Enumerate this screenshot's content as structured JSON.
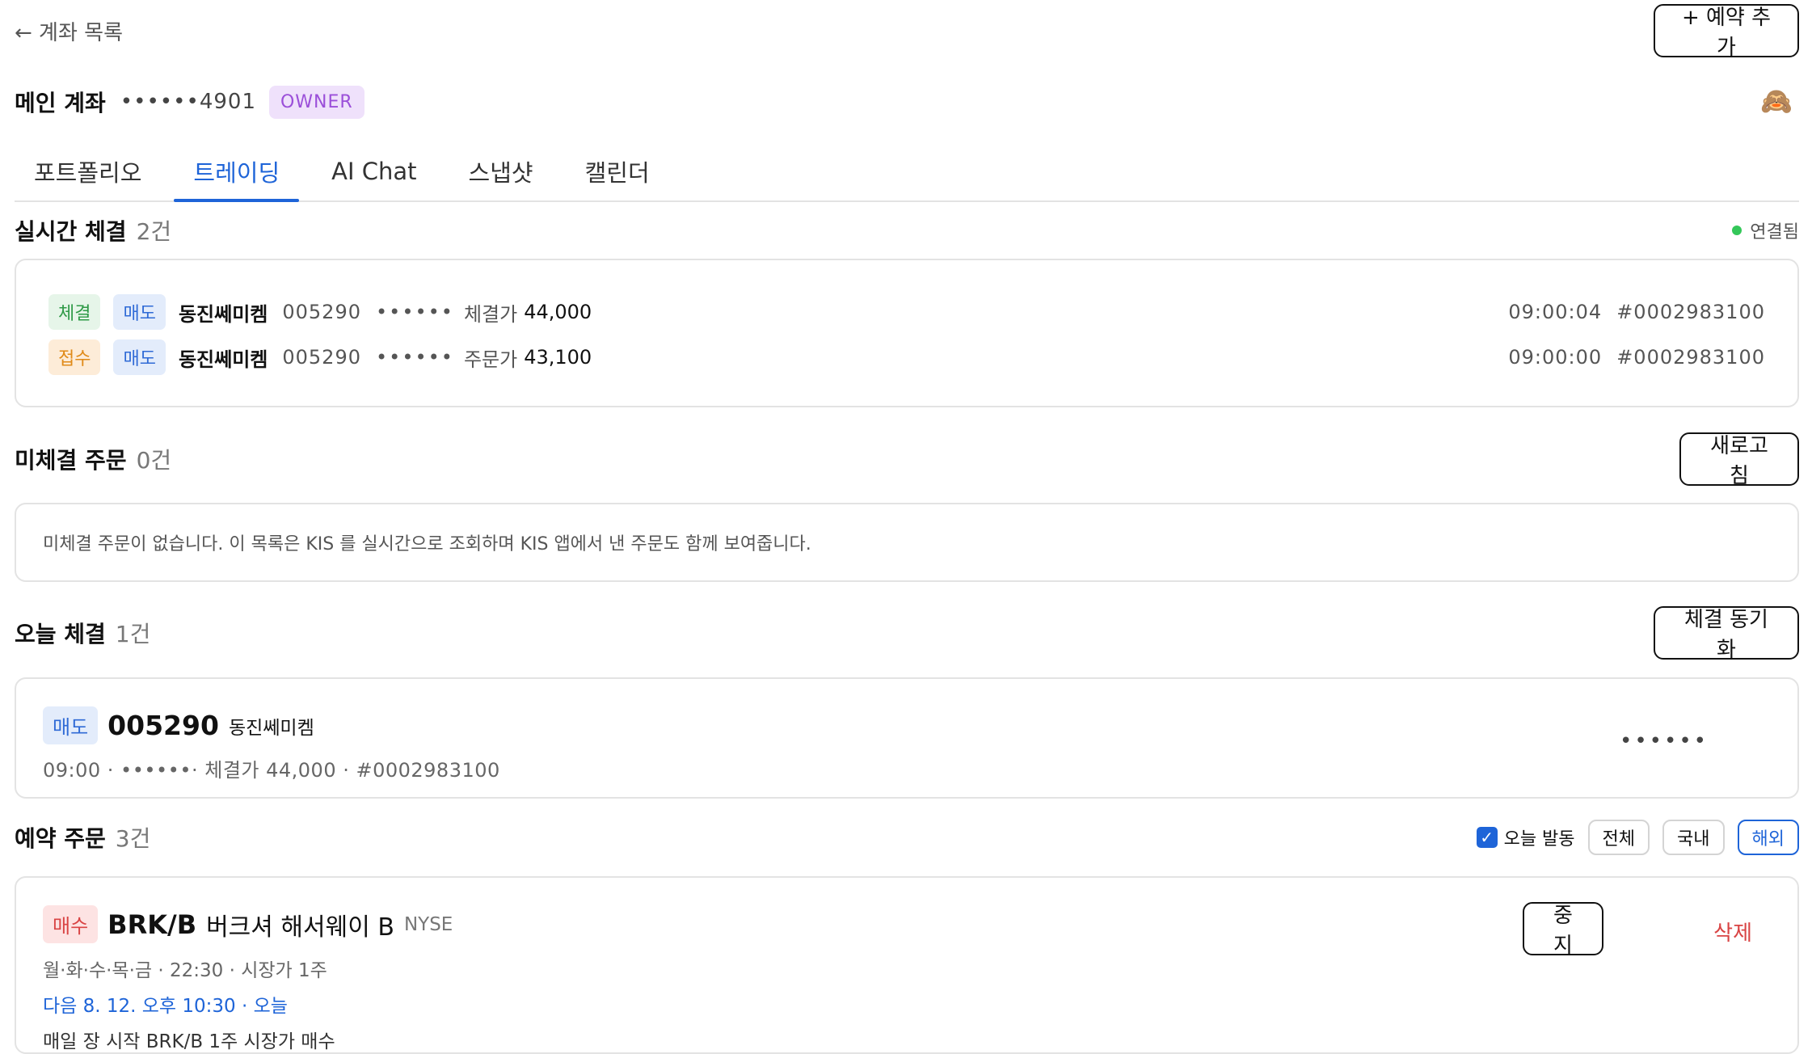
{
  "header": {
    "back_label": "← 계좌 목록",
    "add_reservation_label": "+ 예약 추가"
  },
  "account": {
    "name": "메인 계좌",
    "number": "••••••4901",
    "role": "OWNER",
    "avatar_emoji": "🙈"
  },
  "tabs": [
    {
      "label": "포트폴리오",
      "active": false
    },
    {
      "label": "트레이딩",
      "active": true
    },
    {
      "label": "AI Chat",
      "active": false
    },
    {
      "label": "스냅샷",
      "active": false
    },
    {
      "label": "캘린더",
      "active": false
    }
  ],
  "realtime": {
    "title": "실시간 체결",
    "count": "2건",
    "status": "연결됨",
    "rows": [
      {
        "status": "체결",
        "side": "매도",
        "name": "동진쎄미켐",
        "code": "005290",
        "masked": "••••••",
        "price_label": "체결가",
        "price": "44,000",
        "time": "09:00:04",
        "order_id": "#0002983100"
      },
      {
        "status": "접수",
        "side": "매도",
        "name": "동진쎄미켐",
        "code": "005290",
        "masked": "••••••",
        "price_label": "주문가",
        "price": "43,100",
        "time": "09:00:00",
        "order_id": "#0002983100"
      }
    ]
  },
  "pending": {
    "title": "미체결 주문",
    "count": "0건",
    "refresh_label": "새로고침",
    "empty_text": "미체결 주문이 없습니다. 이 목록은 KIS 를 실시간으로 조회하며 KIS 앱에서 낸 주문도 함께 보여줍니다."
  },
  "today": {
    "title": "오늘 체결",
    "count": "1건",
    "sync_label": "체결 동기화",
    "fill": {
      "side": "매도",
      "code": "005290",
      "name": "동진쎄미켐",
      "detail": "09:00 · ••••••· 체결가 44,000 · #0002983100",
      "masked_right": "••••••"
    }
  },
  "reservations": {
    "title": "예약 주문",
    "count": "3건",
    "today_checkbox_label": "오늘 발동",
    "filters": [
      {
        "label": "전체",
        "selected": false
      },
      {
        "label": "국내",
        "selected": false
      },
      {
        "label": "해외",
        "selected": true
      }
    ],
    "item": {
      "side": "매수",
      "ticker": "BRK/B",
      "name": "버크셔 해서웨이 B",
      "exchange": "NYSE",
      "schedule": "월·화·수·목·금 · 22:30 · 시장가 1주",
      "next_run": "다음 8. 12. 오후 10:30 · 오늘",
      "description": "매일 장 시작 BRK/B 1주 시장가 매수",
      "stop_label": "중지",
      "delete_label": "삭제"
    }
  },
  "colors": {
    "accent": "#1e64d8",
    "connected": "#34c759",
    "danger": "#d94444",
    "owner_badge": "#9b4fd9"
  }
}
